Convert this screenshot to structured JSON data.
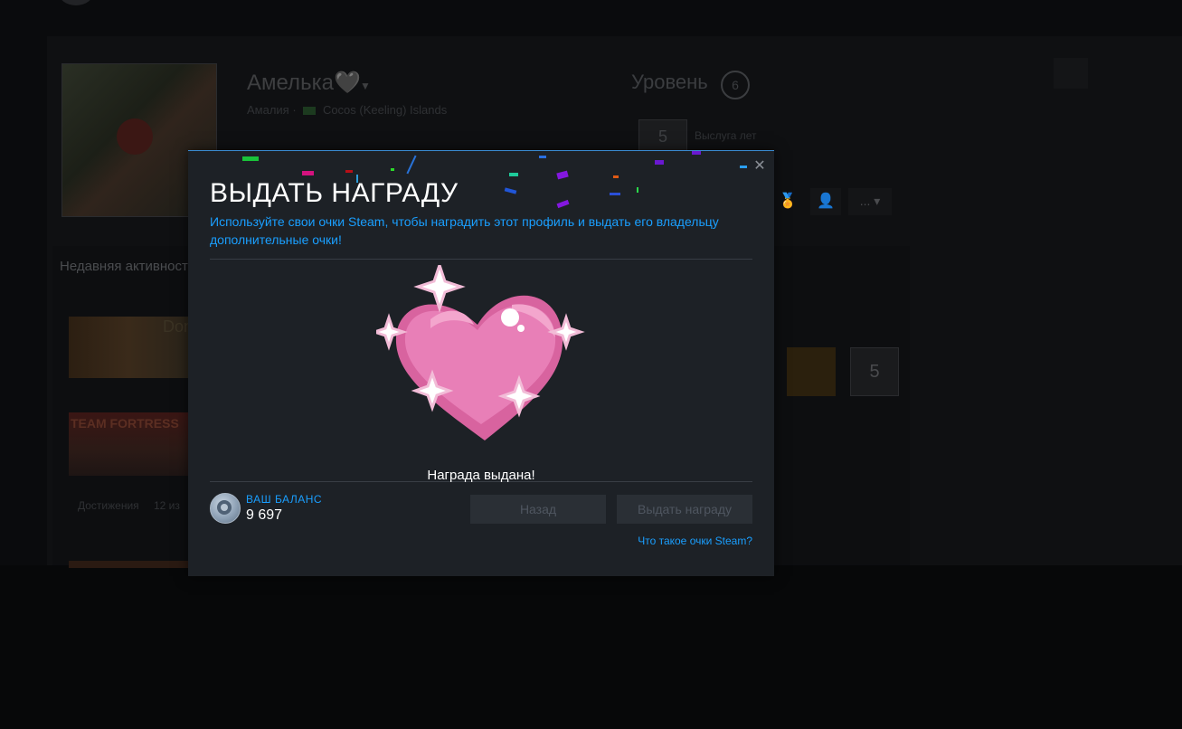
{
  "background_profile": {
    "display_name": "Амелька🖤",
    "real_name": "Амалия",
    "location": "Cocos (Keeling) Islands",
    "level_label": "Уровень",
    "level_value": "6",
    "years_badge": "5",
    "years_label": "Выслуга лет",
    "more_button": "...",
    "recent_activity_title": "Недавняя активность",
    "game1_title": "Don't Starve Together",
    "game2_title": "TEAM FORTRESS",
    "achievements_label": "Достижения",
    "achievements_count": "12 из",
    "badge_five": "5"
  },
  "modal": {
    "title": "ВЫДАТЬ НАГРАДУ",
    "description": "Используйте свои очки Steam, чтобы наградить этот профиль и выдать его владельцу дополнительные очки!",
    "award_message": "Награда выдана!",
    "balance_label": "ВАШ БАЛАНС",
    "balance_value": "9 697",
    "back_button": "Назад",
    "award_button": "Выдать награду",
    "help_link": "Что такое очки Steam?",
    "close_symbol": "✕"
  },
  "icons": {
    "close": "close-icon",
    "heart": "heart-award-icon",
    "steam_points": "steam-points-coin-icon"
  },
  "colors": {
    "accent_blue": "#1a9fff",
    "modal_bg": "#1d2126",
    "heart_pink": "#e87fb7"
  }
}
